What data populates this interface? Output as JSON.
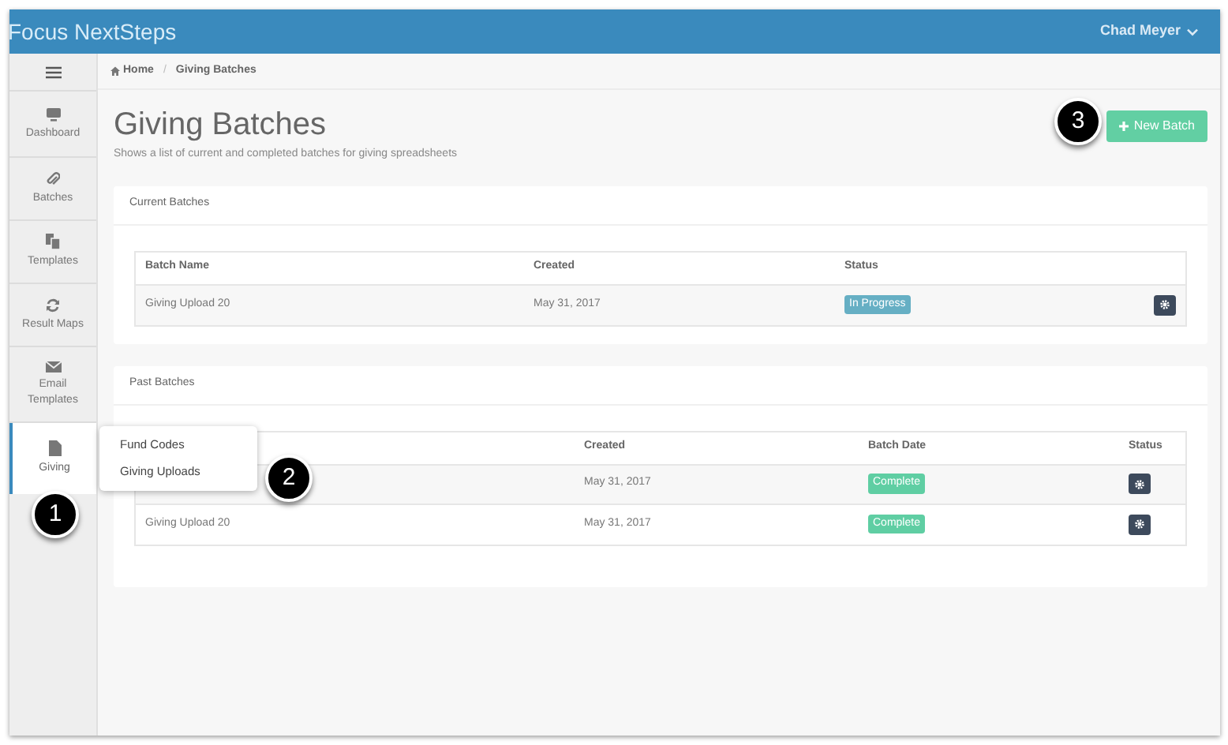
{
  "header": {
    "brand": "Focus NextSteps",
    "user": "Chad Meyer"
  },
  "sidebar": {
    "items": [
      {
        "label": "Dashboard",
        "selected": false
      },
      {
        "label": "Batches",
        "selected": false
      },
      {
        "label": "Templates",
        "selected": false
      },
      {
        "label": "Result Maps",
        "selected": false
      },
      {
        "label": "Email Templates",
        "selected": false
      },
      {
        "label": "Giving",
        "selected": true
      }
    ]
  },
  "submenu": [
    "Fund Codes",
    "Giving Uploads"
  ],
  "breadcrumb": {
    "items": [
      "Home",
      "Giving Batches"
    ],
    "separator": "/"
  },
  "page": {
    "title": "Giving Batches",
    "subtitle": "Shows a list of current and completed batches for giving spreadsheets",
    "new_button": "New Batch"
  },
  "current_batches": {
    "title": "Current Batches",
    "columns": [
      "Batch Name",
      "Created",
      "Status"
    ],
    "rows": [
      {
        "name": "Giving Upload 20",
        "created": "May 31, 2017",
        "status": "In Progress",
        "color": "#66afc4"
      }
    ]
  },
  "past_batches": {
    "title": "Past Batches",
    "columns": [
      "Created",
      "Batch Date",
      "Status"
    ],
    "rows": [
      {
        "created": "May 31, 2017",
        "status": "Complete",
        "color": "#5fcea3"
      },
      {
        "name": "Giving Upload 20",
        "created": "May 31, 2017",
        "status": "Complete",
        "color": "#5fcea3"
      }
    ]
  },
  "callouts": [
    "1",
    "2",
    "3"
  ]
}
